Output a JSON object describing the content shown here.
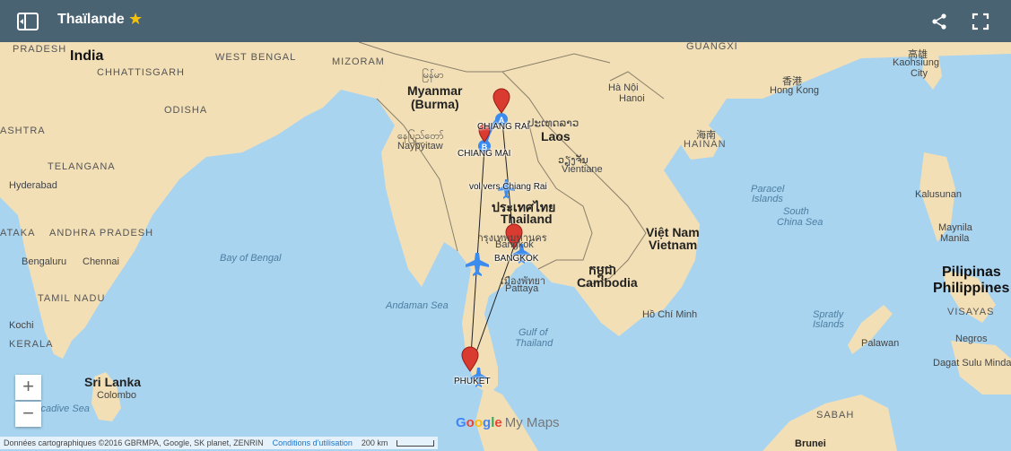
{
  "header": {
    "title": "Thaïlande",
    "star": "★"
  },
  "map": {
    "countries": {
      "india": "India",
      "myanmar_script": "မြန်မာ",
      "myanmar": "Myanmar",
      "myanmar_burma": "(Burma)",
      "laos_script": "ປະເທດລາວ",
      "laos": "Laos",
      "thai_script": "ประเทศไทย",
      "thailand": "Thailand",
      "vietnam1": "Việt Nam",
      "vietnam2": "Vietnam",
      "cambodia_script": "កម្ពុជា",
      "cambodia": "Cambodia",
      "sri_lanka": "Sri Lanka",
      "philippines1": "Pilipinas",
      "philippines2": "Philippines"
    },
    "states": {
      "pradesh": "PRADESH",
      "chhattisgarh": "CHHATTISGARH",
      "west_bengal": "WEST BENGAL",
      "mizoram": "MIZORAM",
      "odisha": "ODISHA",
      "ashtra": "ASHTRA",
      "telangana": "TELANGANA",
      "ataka": "ATAKA",
      "andhra_pradesh": "ANDHRA PRADESH",
      "tamil_nadu": "TAMIL NADU",
      "kerala": "KERALA",
      "guangxi": "GUANGXI",
      "hainan_cn": "海南",
      "hainan": "HAINAN",
      "visayas": "VISAYAS",
      "sabah": "SABAH",
      "brunei": "Brunei"
    },
    "cities": {
      "hyderabad": "Hyderabad",
      "bengaluru": "Bengaluru",
      "chennai": "Chennai",
      "kochi": "Kochi",
      "colombo": "Colombo",
      "naypyitaw_script": "နေပြည်တော်",
      "naypyitaw": "Naypyitaw",
      "vientiane_script": "ວຽງຈັນ",
      "vientiane": "Vientiane",
      "hanoi_script": "Hà Nội",
      "hanoi": "Hanoi",
      "hongkong_cn": "香港",
      "hongkong": "Hong Kong",
      "kaohsiung_cn": "高雄",
      "kaohsiung": "Kaohsiung",
      "kaohsiung_city": "City",
      "bangkok_script": "กรุงเทพมหานคร",
      "bangkok": "Bangkok",
      "pattaya_script": "เมืองพัทยา",
      "pattaya": "Pattaya",
      "hochiminh": "Hồ Chí Minh",
      "palawan": "Palawan",
      "negros": "Negros",
      "mindanao": "Dagat Sulu Mindanao",
      "maynila": "Maynila",
      "manila": "Manila",
      "kalusunan": "Kalusunan"
    },
    "seas": {
      "bay_of_bengal": "Bay of Bengal",
      "andaman_sea": "Andaman Sea",
      "gulf_of_thailand1": "Gulf of",
      "gulf_of_thailand2": "Thailand",
      "south_china_sea1": "South",
      "south_china_sea2": "China Sea",
      "paracel1": "Paracel",
      "paracel2": "Islands",
      "spratly1": "Spratly",
      "spratly2": "Islands",
      "laccadive": "ccadive Sea"
    },
    "route_labels": {
      "chiang_rai": "CHIANG RAI",
      "chiang_mai": "CHIANG MAI",
      "vol": "vol vers Chiang Rai",
      "bangkok": "BANGKOK",
      "phuket": "PHUKET"
    },
    "colors": {
      "land": "#f2dfb6",
      "water": "#a8d4f0",
      "pin": "#d93b30",
      "route_blue": "#3c8cf0"
    }
  },
  "controls": {
    "zoom_in": "+",
    "zoom_out": "−"
  },
  "footer": {
    "attribution": "Données cartographiques ©2016 GBRMPA, Google, SK planet, ZENRIN",
    "terms": "Conditions d'utilisation",
    "scale": "200 km",
    "logo_my_maps": "My Maps"
  }
}
